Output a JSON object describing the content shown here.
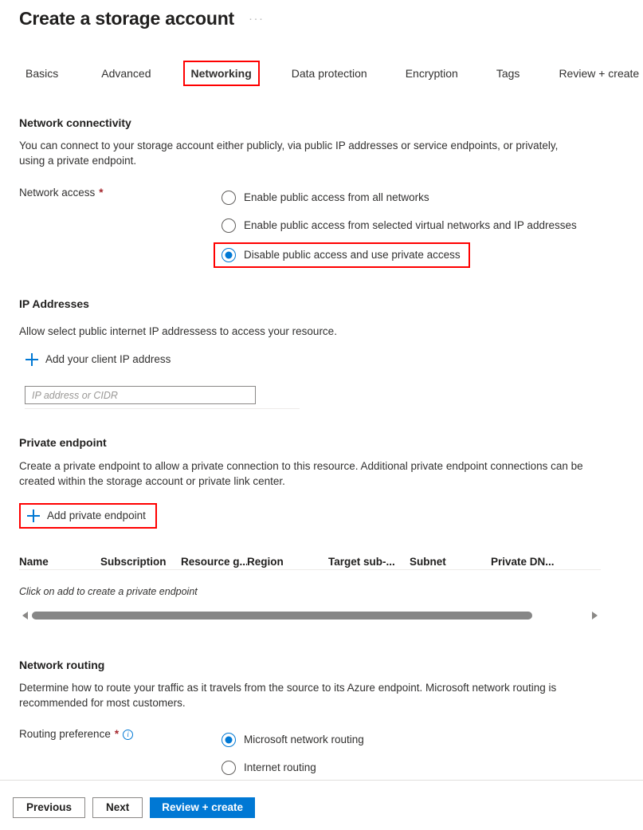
{
  "header": {
    "title": "Create a storage account",
    "ellipsis": "···"
  },
  "tabs": [
    {
      "label": "Basics",
      "selected": false
    },
    {
      "label": "Advanced",
      "selected": false
    },
    {
      "label": "Networking",
      "selected": true
    },
    {
      "label": "Data protection",
      "selected": false
    },
    {
      "label": "Encryption",
      "selected": false
    },
    {
      "label": "Tags",
      "selected": false
    },
    {
      "label": "Review + create",
      "selected": false
    }
  ],
  "network_connectivity": {
    "heading": "Network connectivity",
    "description": "You can connect to your storage account either publicly, via public IP addresses or service endpoints, or privately, using a private endpoint.",
    "field_label": "Network access",
    "required_marker": "*",
    "options": [
      {
        "label": "Enable public access from all networks",
        "selected": false,
        "highlighted": false
      },
      {
        "label": "Enable public access from selected virtual networks and IP addresses",
        "selected": false,
        "highlighted": false
      },
      {
        "label": "Disable public access and use private access",
        "selected": true,
        "highlighted": true
      }
    ]
  },
  "ip_addresses": {
    "heading": "IP Addresses",
    "description": "Allow select public internet IP addressess to access your resource.",
    "add_client_ip_label": "Add your client IP address",
    "input_value": "",
    "input_placeholder": "IP address or CIDR"
  },
  "private_endpoint": {
    "heading": "Private endpoint",
    "description": "Create a private endpoint to allow a private connection to this resource. Additional private endpoint connections can be created within the storage account or private link center.",
    "add_button_label": "Add private endpoint",
    "columns": [
      "Name",
      "Subscription",
      "Resource g...",
      "Region",
      "Target sub-...",
      "Subnet",
      "Private DN..."
    ],
    "empty_message": "Click on add to create a private endpoint"
  },
  "network_routing": {
    "heading": "Network routing",
    "description": "Determine how to route your traffic as it travels from the source to its Azure endpoint. Microsoft network routing is recommended for most customers.",
    "field_label": "Routing preference",
    "required_marker": "*",
    "info_glyph": "i",
    "options": [
      {
        "label": "Microsoft network routing",
        "selected": true
      },
      {
        "label": "Internet routing",
        "selected": false
      }
    ]
  },
  "footer": {
    "previous_label": "Previous",
    "next_label": "Next",
    "review_create_label": "Review + create"
  },
  "colors": {
    "accent": "#0078d4",
    "annotation": "#ff0000",
    "required": "#a4262c",
    "text": "#323130"
  }
}
